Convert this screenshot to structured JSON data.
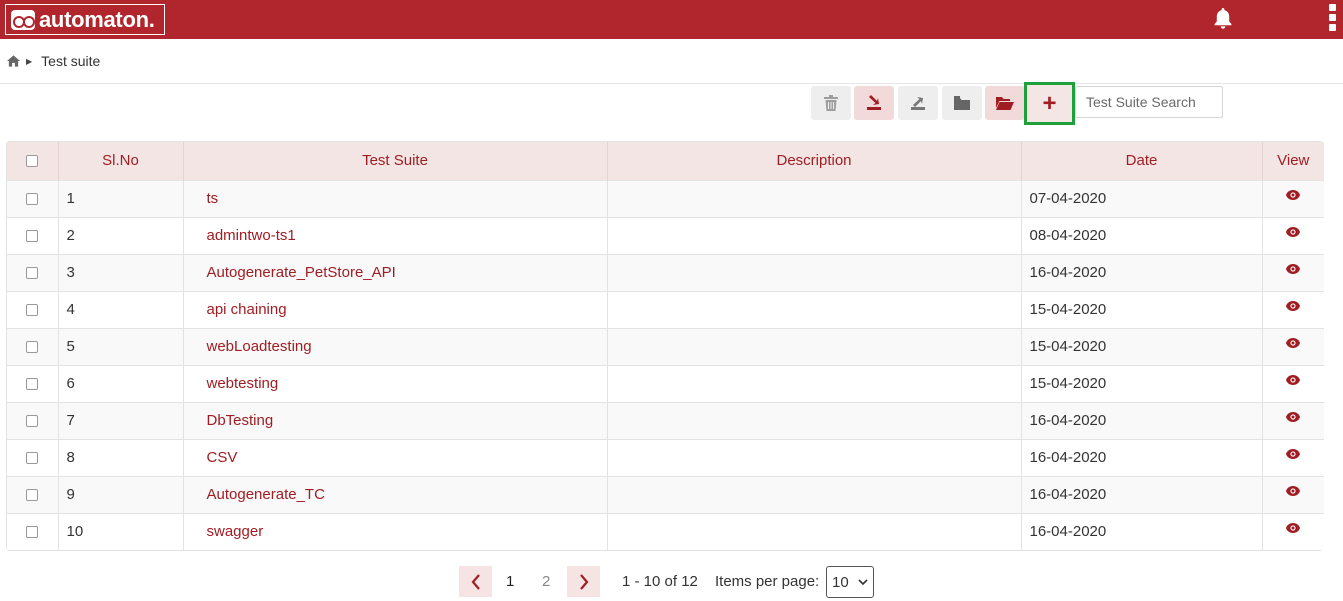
{
  "app": {
    "brand": "automaton."
  },
  "breadcrumb": {
    "current": "Test suite"
  },
  "toolbar": {
    "search_placeholder": "Test Suite Search",
    "add_label": "+"
  },
  "table": {
    "columns": [
      "Sl.No",
      "Test Suite",
      "Description",
      "Date",
      "View"
    ],
    "rows": [
      {
        "sl": "1",
        "name": "ts",
        "description": "",
        "date": "07-04-2020"
      },
      {
        "sl": "2",
        "name": "admintwo-ts1",
        "description": "",
        "date": "08-04-2020"
      },
      {
        "sl": "3",
        "name": "Autogenerate_PetStore_API",
        "description": "",
        "date": "16-04-2020"
      },
      {
        "sl": "4",
        "name": "api chaining",
        "description": "",
        "date": "15-04-2020"
      },
      {
        "sl": "5",
        "name": "webLoadtesting",
        "description": "",
        "date": "15-04-2020"
      },
      {
        "sl": "6",
        "name": "webtesting",
        "description": "",
        "date": "15-04-2020"
      },
      {
        "sl": "7",
        "name": "DbTesting",
        "description": "",
        "date": "16-04-2020"
      },
      {
        "sl": "8",
        "name": "CSV",
        "description": "",
        "date": "16-04-2020"
      },
      {
        "sl": "9",
        "name": "Autogenerate_TC",
        "description": "",
        "date": "16-04-2020"
      },
      {
        "sl": "10",
        "name": "swagger",
        "description": "",
        "date": "16-04-2020"
      }
    ]
  },
  "pagination": {
    "pages": [
      "1",
      "2"
    ],
    "current_page": "1",
    "range_text": "1 - 10 of 12",
    "items_per_page_label": "Items per page:",
    "items_per_page_value": "10"
  },
  "colors": {
    "brand": "#b0262c",
    "accent": "#a01d23",
    "highlight_border": "#1fa03a"
  },
  "icons": [
    "home-icon",
    "bell-icon",
    "more-vert-icon",
    "trash-icon",
    "import-icon",
    "export-icon",
    "folder-icon",
    "folder-open-icon",
    "plus-icon",
    "eye-icon",
    "chevron-left-icon",
    "chevron-right-icon"
  ]
}
